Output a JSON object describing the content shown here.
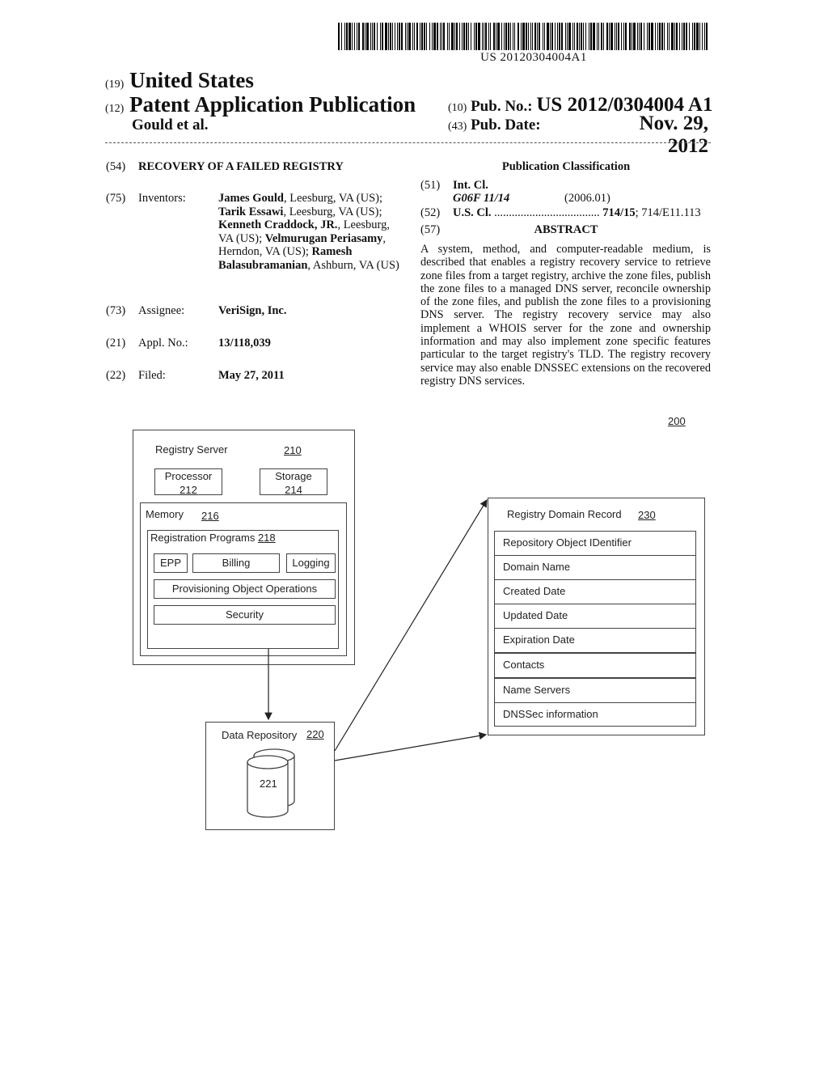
{
  "header": {
    "barcode_number": "US 20120304004A1",
    "country_code": "(19)",
    "country": "United States",
    "type_code": "(12)",
    "type": "Patent Application Publication",
    "authors": "Gould et al.",
    "pub_no_code": "(10)",
    "pub_no_label": "Pub. No.:",
    "pub_no": "US 2012/0304004 A1",
    "pub_date_code": "(43)",
    "pub_date_label": "Pub. Date:",
    "pub_date": "Nov. 29, 2012"
  },
  "bibliographic": {
    "title": {
      "code": "(54)",
      "value": "RECOVERY OF A FAILED REGISTRY"
    },
    "inventors": {
      "code": "(75)",
      "label": "Inventors:",
      "list": [
        {
          "name": "James Gould",
          "location": ", Leesburg, VA (US);"
        },
        {
          "name": "Tarik Essawi",
          "location": ", Leesburg, VA (US);"
        },
        {
          "name": "Kenneth Craddock, JR.",
          "location": ", Leesburg, VA (US);"
        },
        {
          "name": "Velmurugan Periasamy",
          "location": ", Herndon, VA (US);"
        },
        {
          "name": "Ramesh Balasubramanian",
          "location": ", Ashburn, VA (US)"
        }
      ]
    },
    "assignee": {
      "code": "(73)",
      "label": "Assignee:",
      "value": "VeriSign, Inc."
    },
    "appl_no": {
      "code": "(21)",
      "label": "Appl. No.:",
      "value": "13/118,039"
    },
    "filed": {
      "code": "(22)",
      "label": "Filed:",
      "value": "May 27, 2011"
    }
  },
  "classification": {
    "title": "Publication Classification",
    "int_cl": {
      "code": "(51)",
      "label": "Int. Cl.",
      "class": "G06F 11/14",
      "version": "(2006.01)"
    },
    "us_cl": {
      "code": "(52)",
      "label": "U.S. Cl.",
      "dots": "....................................",
      "primary": "714/15",
      "secondary": "; 714/E11.113"
    }
  },
  "abstract": {
    "code": "(57)",
    "title": "ABSTRACT",
    "text": "A system, method, and computer-readable medium, is described that enables a registry recovery service to retrieve zone files from a target registry, archive the zone files, publish the zone files to a managed DNS server, reconcile ownership of the zone files, and publish the zone files to a provisioning DNS server. The registry recovery service may also implement a WHOIS server for the zone and ownership information and may also implement zone specific features particular to the target registry's TLD. The registry recovery service may also enable DNSSEC extensions on the recovered registry DNS services."
  },
  "figure": {
    "ref": "200",
    "registry_server": {
      "label": "Registry Server",
      "ref": "210"
    },
    "processor": {
      "label": "Processor",
      "ref": "212"
    },
    "storage": {
      "label": "Storage",
      "ref": "214"
    },
    "memory": {
      "label": "Memory",
      "ref": "216"
    },
    "registration_programs": {
      "label": "Registration Programs",
      "ref": "218"
    },
    "modules": [
      "EPP",
      "Billing",
      "Logging",
      "Provisioning Object Operations",
      "Security"
    ],
    "data_repository": {
      "label": "Data Repository",
      "ref": "220",
      "db_ref": "221"
    },
    "domain_record": {
      "label": "Registry Domain Record",
      "ref": "230",
      "fields": [
        "Repository Object IDentifier",
        "Domain Name",
        "Created Date",
        "Updated Date",
        "Expiration Date",
        "Contacts",
        "Name Servers",
        "DNSSec information"
      ]
    }
  }
}
